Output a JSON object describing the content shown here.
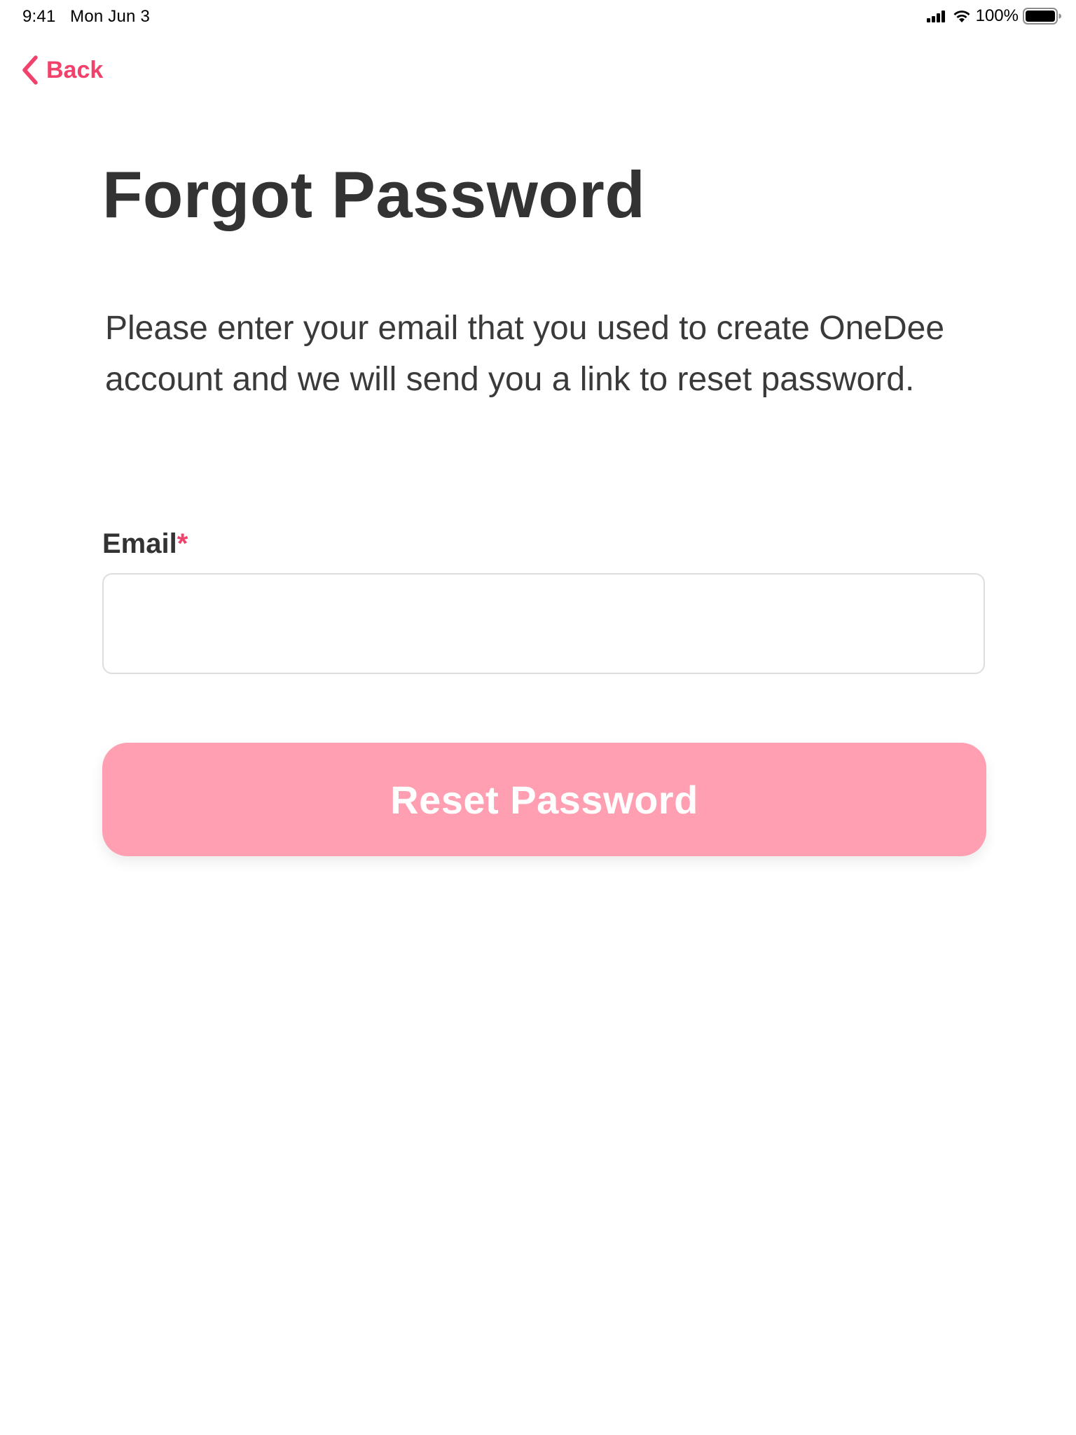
{
  "status_bar": {
    "time": "9:41",
    "date": "Mon Jun 3",
    "battery_percent": "100%",
    "icons": [
      "signal-icon",
      "wifi-icon",
      "battery-icon"
    ]
  },
  "nav": {
    "back_label": "Back",
    "back_icon": "chevron-left-icon"
  },
  "page": {
    "title": "Forgot Password",
    "description": "Please enter your email that you used to create OneDee account and we will send you a link to reset password."
  },
  "form": {
    "email_label": "Email",
    "required_mark": "*",
    "email_value": "",
    "email_placeholder": ""
  },
  "actions": {
    "reset_label": "Reset Password"
  },
  "colors": {
    "accent": "#f0426b",
    "button_bg": "#ff9fb1",
    "text": "#333333",
    "input_border": "#dddddd"
  }
}
